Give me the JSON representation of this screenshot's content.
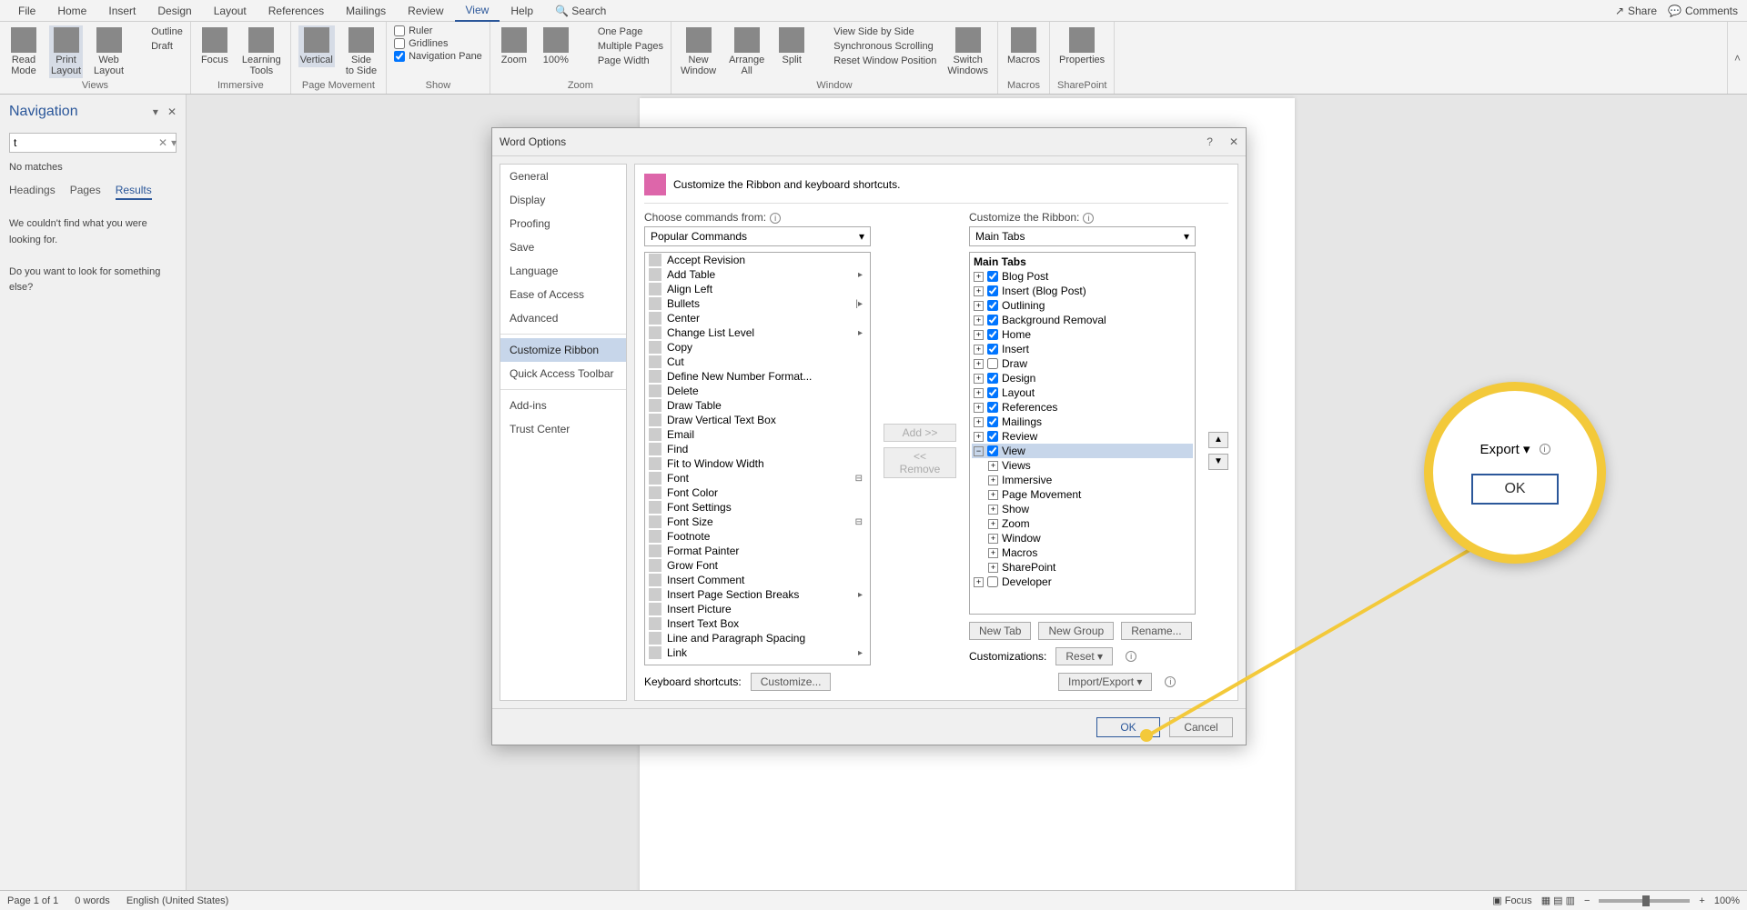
{
  "tabs": [
    "File",
    "Home",
    "Insert",
    "Design",
    "Layout",
    "References",
    "Mailings",
    "Review",
    "View",
    "Help",
    "Search"
  ],
  "active_tab": 8,
  "share": "Share",
  "comments": "Comments",
  "ribbon": {
    "views": {
      "label": "Views",
      "read": "Read\nMode",
      "print": "Print\nLayout",
      "web": "Web\nLayout",
      "outline": "Outline",
      "draft": "Draft"
    },
    "immersive": {
      "label": "Immersive",
      "focus": "Focus",
      "tools": "Learning\nTools"
    },
    "pagemove": {
      "label": "Page Movement",
      "vertical": "Vertical",
      "side": "Side\nto Side"
    },
    "show": {
      "label": "Show",
      "ruler": "Ruler",
      "gridlines": "Gridlines",
      "navpane": "Navigation Pane"
    },
    "zoom": {
      "label": "Zoom",
      "zoom": "Zoom",
      "hundred": "100%",
      "one": "One Page",
      "multi": "Multiple Pages",
      "width": "Page Width"
    },
    "window": {
      "label": "Window",
      "new": "New\nWindow",
      "arrange": "Arrange\nAll",
      "split": "Split",
      "sidebyside": "View Side by Side",
      "syncscroll": "Synchronous Scrolling",
      "resetpos": "Reset Window Position",
      "switch": "Switch\nWindows"
    },
    "macros": {
      "label": "Macros",
      "macros": "Macros"
    },
    "sharepoint": {
      "label": "SharePoint",
      "props": "Properties"
    }
  },
  "nav": {
    "title": "Navigation",
    "search": "t",
    "nomatch": "No matches",
    "tabs": [
      "Headings",
      "Pages",
      "Results"
    ],
    "msg1": "We couldn't find what you were looking for.",
    "msg2": "Do you want to look for something else?"
  },
  "dialog": {
    "title": "Word Options",
    "sidebar": [
      "General",
      "Display",
      "Proofing",
      "Save",
      "Language",
      "Ease of Access",
      "Advanced",
      "",
      "Customize Ribbon",
      "Quick Access Toolbar",
      "",
      "Add-ins",
      "Trust Center"
    ],
    "sidebar_sel": 8,
    "header": "Customize the Ribbon and keyboard shortcuts.",
    "choose_label": "Choose commands from:",
    "choose_value": "Popular Commands",
    "custom_label": "Customize the Ribbon:",
    "custom_value": "Main Tabs",
    "commands": [
      {
        "t": "Accept Revision"
      },
      {
        "t": "Add Table",
        "a": "▸"
      },
      {
        "t": "Align Left"
      },
      {
        "t": "Bullets",
        "a": "|▸"
      },
      {
        "t": "Center"
      },
      {
        "t": "Change List Level",
        "a": "▸"
      },
      {
        "t": "Copy"
      },
      {
        "t": "Cut"
      },
      {
        "t": "Define New Number Format..."
      },
      {
        "t": "Delete"
      },
      {
        "t": "Draw Table"
      },
      {
        "t": "Draw Vertical Text Box"
      },
      {
        "t": "Email"
      },
      {
        "t": "Find"
      },
      {
        "t": "Fit to Window Width"
      },
      {
        "t": "Font",
        "a": "⊟"
      },
      {
        "t": "Font Color"
      },
      {
        "t": "Font Settings"
      },
      {
        "t": "Font Size",
        "a": "⊟"
      },
      {
        "t": "Footnote"
      },
      {
        "t": "Format Painter"
      },
      {
        "t": "Grow Font"
      },
      {
        "t": "Insert Comment"
      },
      {
        "t": "Insert Page  Section Breaks",
        "a": "▸"
      },
      {
        "t": "Insert Picture"
      },
      {
        "t": "Insert Text Box"
      },
      {
        "t": "Line and Paragraph Spacing"
      },
      {
        "t": "Link",
        "a": "▸"
      }
    ],
    "tree_header": "Main Tabs",
    "tree": [
      {
        "t": "Blog Post",
        "c": true
      },
      {
        "t": "Insert (Blog Post)",
        "c": true
      },
      {
        "t": "Outlining",
        "c": true
      },
      {
        "t": "Background Removal",
        "c": true
      },
      {
        "t": "Home",
        "c": true
      },
      {
        "t": "Insert",
        "c": true
      },
      {
        "t": "Draw",
        "c": false
      },
      {
        "t": "Design",
        "c": true
      },
      {
        "t": "Layout",
        "c": true
      },
      {
        "t": "References",
        "c": true
      },
      {
        "t": "Mailings",
        "c": true
      },
      {
        "t": "Review",
        "c": true
      },
      {
        "t": "View",
        "c": true,
        "sel": true,
        "exp": true,
        "children": [
          "Views",
          "Immersive",
          "Page Movement",
          "Show",
          "Zoom",
          "Window",
          "Macros",
          "SharePoint"
        ]
      },
      {
        "t": "Developer",
        "c": false
      }
    ],
    "add": "Add >>",
    "remove": "<< Remove",
    "newtab": "New Tab",
    "newgroup": "New Group",
    "rename": "Rename...",
    "custlabel": "Customizations:",
    "reset": "Reset ▾",
    "importexport": "Import/Export ▾",
    "kblabel": "Keyboard shortcuts:",
    "customize": "Customize...",
    "ok": "OK",
    "cancel": "Cancel"
  },
  "status": {
    "page": "Page 1 of 1",
    "words": "0 words",
    "lang": "English (United States)",
    "focus": "Focus",
    "zoom": "100%"
  },
  "callout": {
    "export": "Export ▾",
    "ok": "OK"
  }
}
